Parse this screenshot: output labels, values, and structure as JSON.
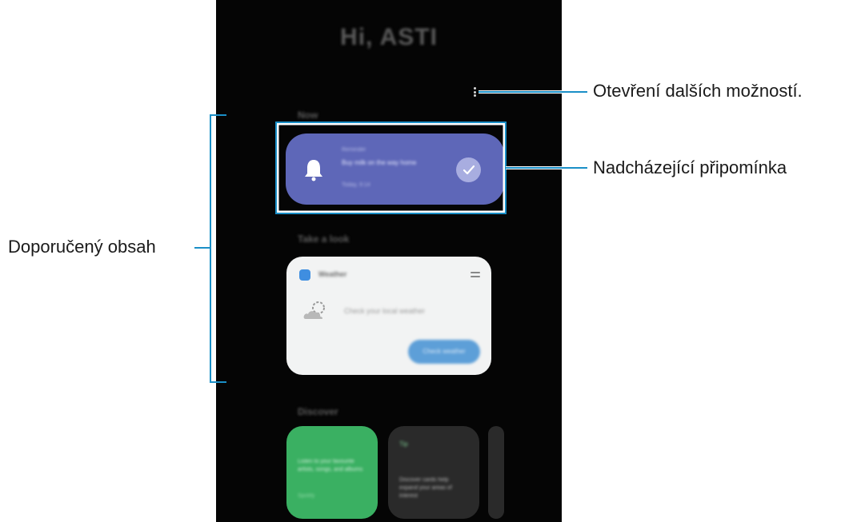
{
  "phone": {
    "greeting": "Hi, ASTI",
    "sections": {
      "now": "Now",
      "take_a_look": "Take a look",
      "discover": "Discover"
    },
    "reminder": {
      "type_label": "Reminder",
      "text": "Buy milk on the way home",
      "date": "Today, 9:14"
    },
    "weather_card": {
      "title": "Weather",
      "message": "Check your local weather",
      "button_label": "Check weather"
    },
    "discover_cards": [
      {
        "text": "Listen to your favourite artists, songs, and albums",
        "source": "Spotify",
        "color": "#3ab062"
      },
      {
        "tag": "Tip",
        "text": "Discover cards help expand your areas of interest",
        "color": "#2a2a2a"
      }
    ],
    "colors": {
      "background": "#050505",
      "reminder": "#5e67b8",
      "weather_button": "#5d9fd8",
      "callout_line": "#1a8fc7"
    }
  },
  "callouts": {
    "more_options": "Otevření dalších možností.",
    "upcoming_reminder": "Nadcházející připomínka",
    "recommended_content": "Doporučený obsah"
  }
}
